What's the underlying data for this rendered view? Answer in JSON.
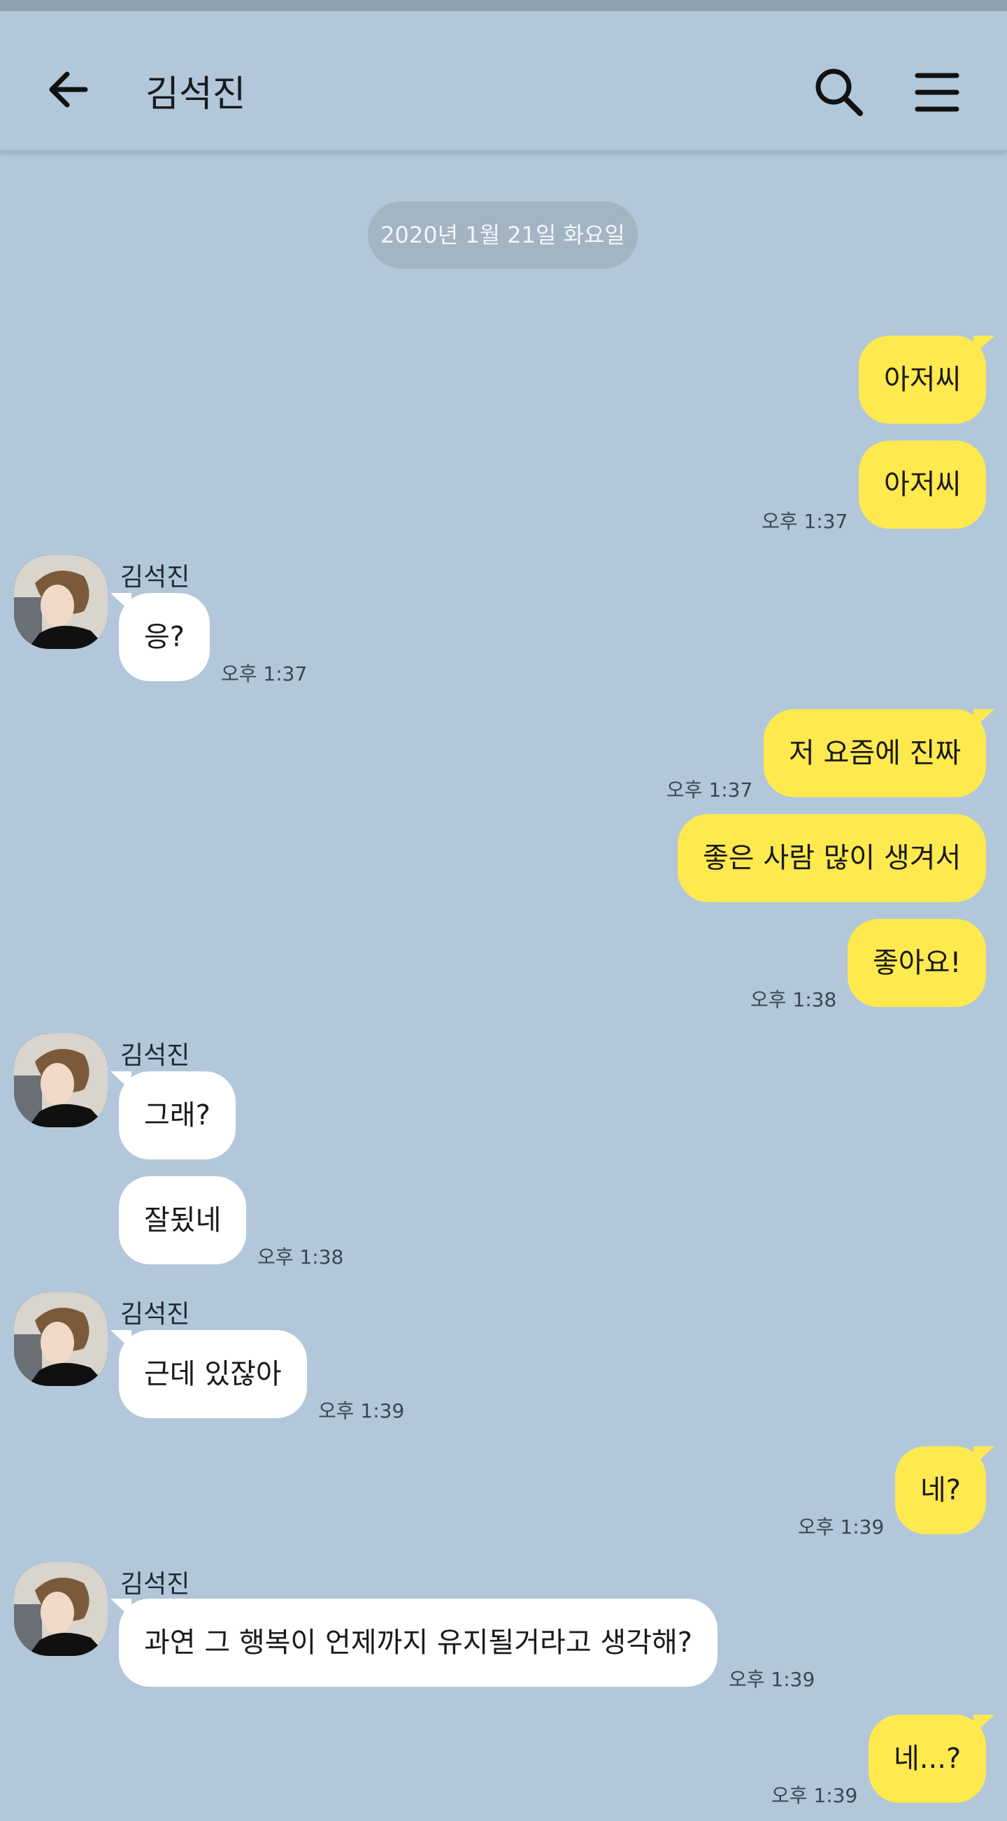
{
  "header": {
    "title": "김석진"
  },
  "date_separator": "2020년 1월 21일 화요일",
  "messages": [
    {
      "text": "아저씨"
    },
    {
      "text": "아저씨",
      "time": "오후 1:37"
    },
    {
      "sender": "김석진",
      "text": "응?",
      "time": "오후 1:37"
    },
    {
      "text": "저 요즘에 진짜",
      "time": "오후 1:37"
    },
    {
      "text": "좋은 사람 많이 생겨서"
    },
    {
      "text": "좋아요!",
      "time": "오후 1:38"
    },
    {
      "sender": "김석진",
      "text": "그래?"
    },
    {
      "text": "잘됬네",
      "time": "오후 1:38"
    },
    {
      "sender": "김석진",
      "text": "근데 있잖아",
      "time": "오후 1:39"
    },
    {
      "text": "네?",
      "time": "오후 1:39"
    },
    {
      "sender": "김석진",
      "text": "과연 그 행복이 언제까지 유지될거라고 생각해?",
      "time": "오후 1:39"
    },
    {
      "text": "네...?",
      "time": "오후 1:39"
    }
  ],
  "colors": {
    "background": "#b2c7da",
    "my_bubble": "#fee94f",
    "other_bubble": "#ffffff"
  }
}
